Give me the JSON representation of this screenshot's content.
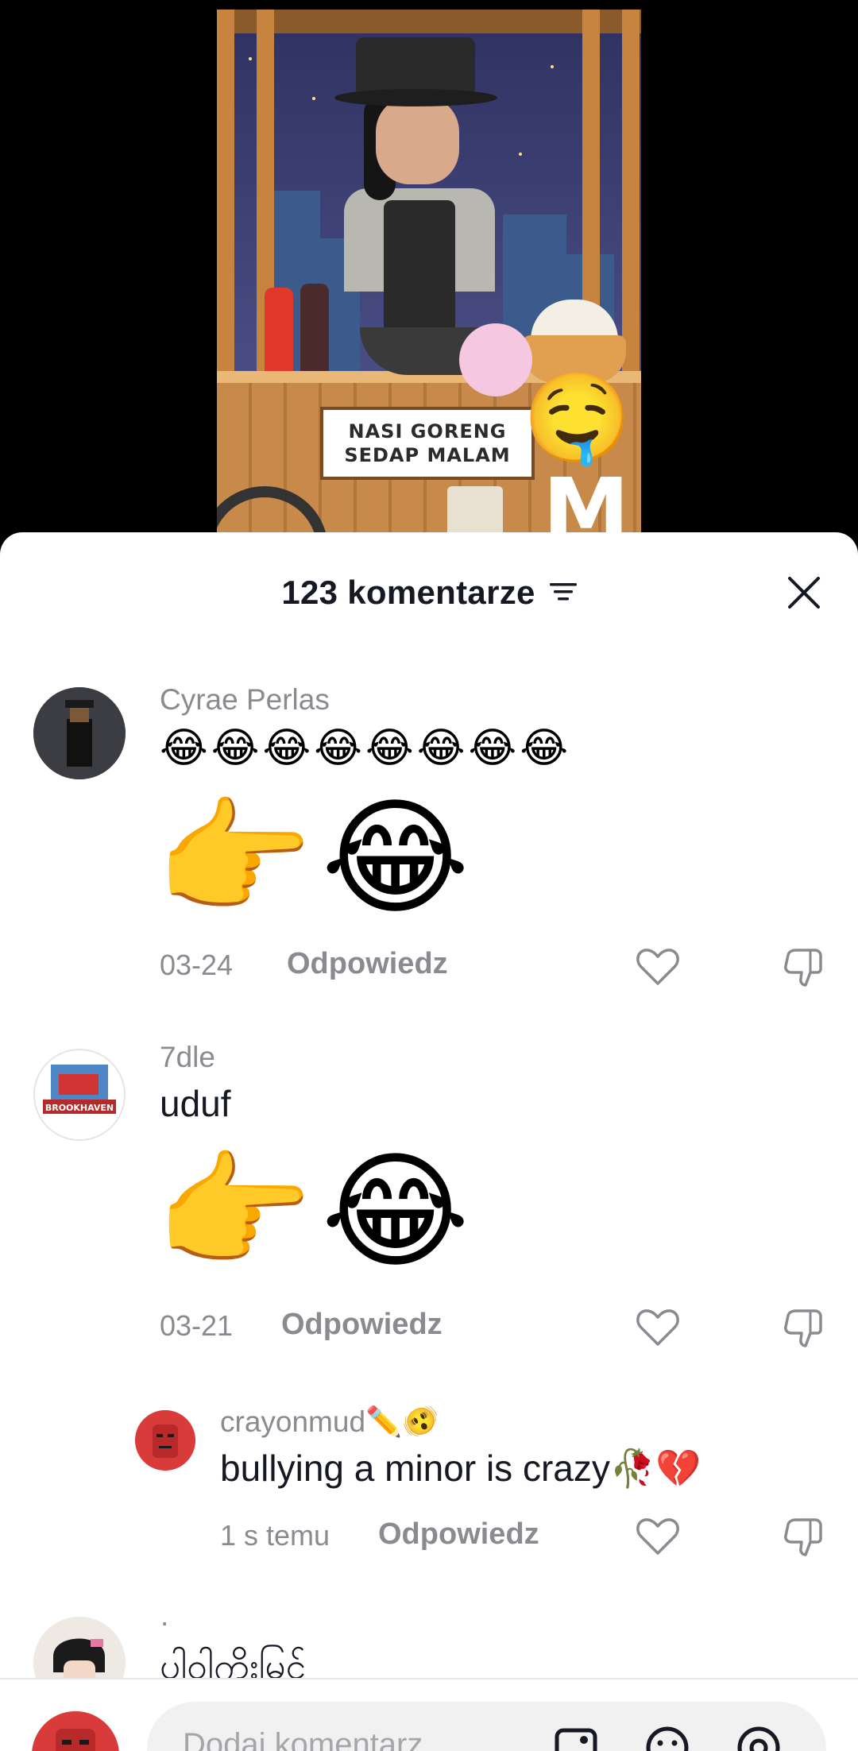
{
  "video": {
    "sign_line1": "NASI GORENG",
    "sign_line2": "SEDAP MALAM",
    "watermark": "M"
  },
  "comments_sheet": {
    "title": "123 komentarze",
    "filter_icon": "filter-icon",
    "close_icon": "close-icon"
  },
  "comments": [
    {
      "username": "Cyrae Perlas",
      "emoji_text": "😂😂😂😂😂😂😂😂",
      "sticker": "👉😂",
      "date": "03-24",
      "reply_label": "Odpowiedz"
    },
    {
      "username": "7dle",
      "text": "uduf",
      "sticker": "👉😂",
      "date": "03-21",
      "reply_label": "Odpowiedz",
      "avatar_label": "BROOKHAVEN"
    },
    {
      "username": "crayonmud✏️🫨",
      "text": "bullying a minor is crazy🥀💔",
      "date": "1 s temu",
      "reply_label": "Odpowiedz",
      "is_reply": true
    },
    {
      "username": "·",
      "text": "ပါဝါကိုးမြင်"
    }
  ],
  "input": {
    "placeholder": "Dodaj komentarz...",
    "icons": [
      "image-icon",
      "emoji-icon",
      "mention-icon"
    ]
  },
  "colors": {
    "sheet_bg": "#ffffff",
    "text_primary": "#161823",
    "text_secondary": "#8a8b91",
    "input_bg": "#f1f1f2"
  }
}
